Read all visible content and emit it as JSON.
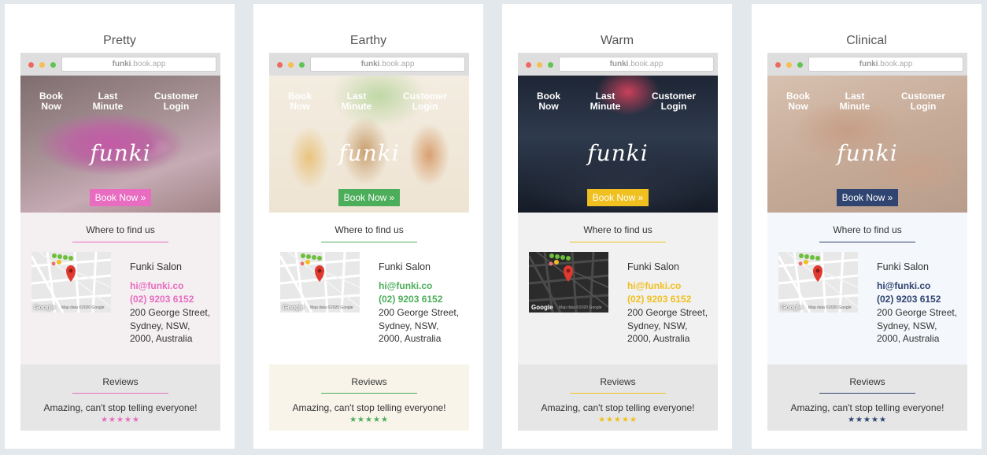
{
  "browser_url": {
    "brand": "funki",
    "rest": ".book.app"
  },
  "nav": {
    "book": [
      "Book",
      "Now"
    ],
    "last": [
      "Last",
      "Minute"
    ],
    "login": [
      "Customer",
      "Login"
    ]
  },
  "logo": "funki",
  "book_button": "Book Now »",
  "find_title": "Where to find us",
  "map": {
    "google_label": "Google",
    "credit": "Map data ©2020 Google"
  },
  "salon_name": "Funki Salon",
  "email": "hi@funki.co",
  "phone": "(02) 9203 6152",
  "address": "200 George Street, Sydney, NSW, 2000, Australia",
  "reviews_title": "Reviews",
  "review_text": "Amazing, can't stop telling everyone!",
  "stars": "★★★★★",
  "themes": [
    {
      "name": "Pretty",
      "accent": "#e86cc0",
      "find_bg": "#f4eff1",
      "reviews_bg": "#e6e6e6",
      "hero": "pretty"
    },
    {
      "name": "Earthy",
      "accent": "#4cae5a",
      "find_bg": "#ffffff",
      "reviews_bg": "#f8f4ea",
      "hero": "earthy"
    },
    {
      "name": "Warm",
      "accent": "#f0c020",
      "find_bg": "#f1f1f1",
      "reviews_bg": "#e6e6e6",
      "hero": "warm"
    },
    {
      "name": "Clinical",
      "accent": "#2f4470",
      "find_bg": "#f4f7fb",
      "reviews_bg": "#e6e6e6",
      "hero": "clinical"
    }
  ]
}
